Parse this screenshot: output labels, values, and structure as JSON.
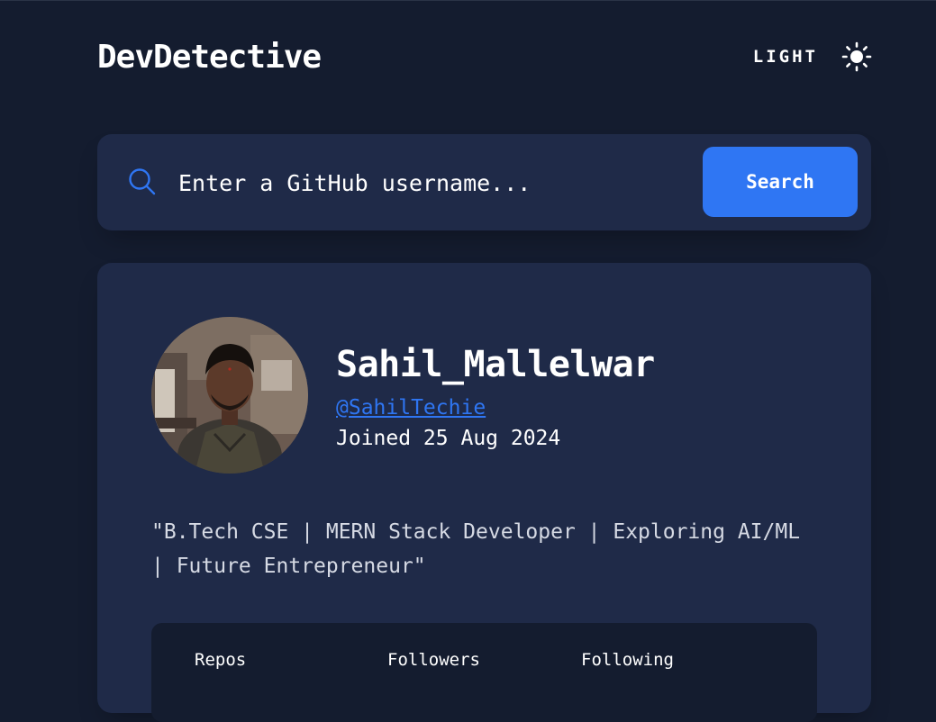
{
  "header": {
    "title": "DevDetective",
    "theme_label": "LIGHT",
    "theme_icon": "sun-icon"
  },
  "search": {
    "placeholder": "Enter a GitHub username...",
    "button_label": "Search",
    "icon": "search-icon"
  },
  "profile": {
    "name": "Sahil_Mallelwar",
    "handle": "@SahilTechie",
    "joined": "Joined 25 Aug 2024",
    "bio": "\"B.Tech CSE | MERN Stack Developer | Exploring AI/ML | Future Entrepreneur\""
  },
  "stats": {
    "repos_label": "Repos",
    "followers_label": "Followers",
    "following_label": "Following"
  },
  "colors": {
    "background": "#141c2f",
    "card": "#1f2a48",
    "accent": "#2f76f3"
  }
}
